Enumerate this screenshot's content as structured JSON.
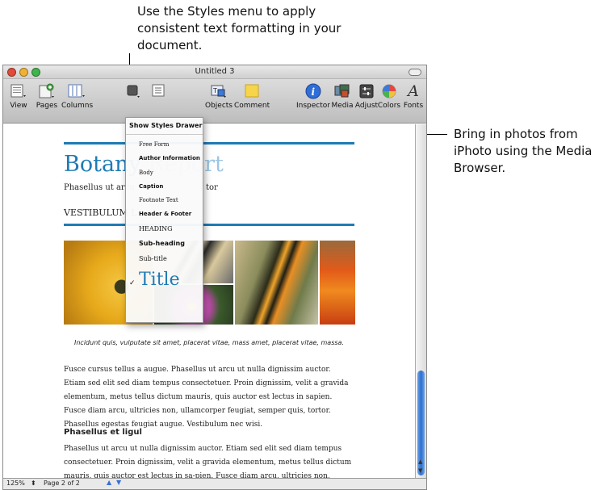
{
  "callouts": {
    "styles": "Use the Styles menu to apply consistent text formatting in your document.",
    "media": "Bring in photos from iPhoto using the Media Browser."
  },
  "window": {
    "title": "Untitled 3"
  },
  "toolbar": {
    "view": "View",
    "pages": "Pages",
    "columns": "Columns",
    "objects": "Objects",
    "comment": "Comment",
    "inspector": "Inspector",
    "media": "Media",
    "adjust": "Adjust",
    "colors": "Colors",
    "fonts": "Fonts"
  },
  "styles_menu": {
    "header": "Show Styles Drawer",
    "items": [
      "Free Form",
      "Author Information",
      "Body",
      "Caption",
      "Footnote Text",
      "Header & Footer",
      "HEADING",
      "Sub-heading",
      "Sub-title",
      "Title"
    ],
    "checked": "✓"
  },
  "document": {
    "title": "Botany",
    "title_rest": "Report",
    "subtitle_line": "Phasellus ut arcu",
    "subtitle_tail": "tor",
    "heading": "VESTIBULUM L",
    "caption": "Incidunt quis, vulputate sit amet, placerat vitae, mass amet, placerat vitae, massa.",
    "body1": "Fusce cursus tellus a augue. Phasellus ut arcu ut nulla dignissim auctor. Etiam sed elit sed diam tempus consectetuer. Proin dignissim, velit a gravida elementum, metus tellus dictum mauris, quis auctor est lectus in sapien. Fusce diam arcu, ultricies non, ullamcorper feugiat, semper quis, tortor. Phasellus egestas feugiat augue. Vestibulum nec wisi.",
    "subhead": "Phasellus et ligul",
    "body2": "Phasellus ut arcu ut nulla dignissim auctor. Etiam sed elit sed diam tempus consectetuer. Proin dignissim, velit a gravida elementum, metus tellus dictum mauris, quis auctor est lectus in sa-pien. Fusce diam arcu, ultricies non, ullamcorper feugiat, semper quis, tortor. Phasellus egestas"
  },
  "status": {
    "zoom": "125%",
    "page": "Page 2 of 2"
  },
  "colors": {
    "accent": "#1f7bb5",
    "scroll_thumb": "#2c6fd0"
  }
}
